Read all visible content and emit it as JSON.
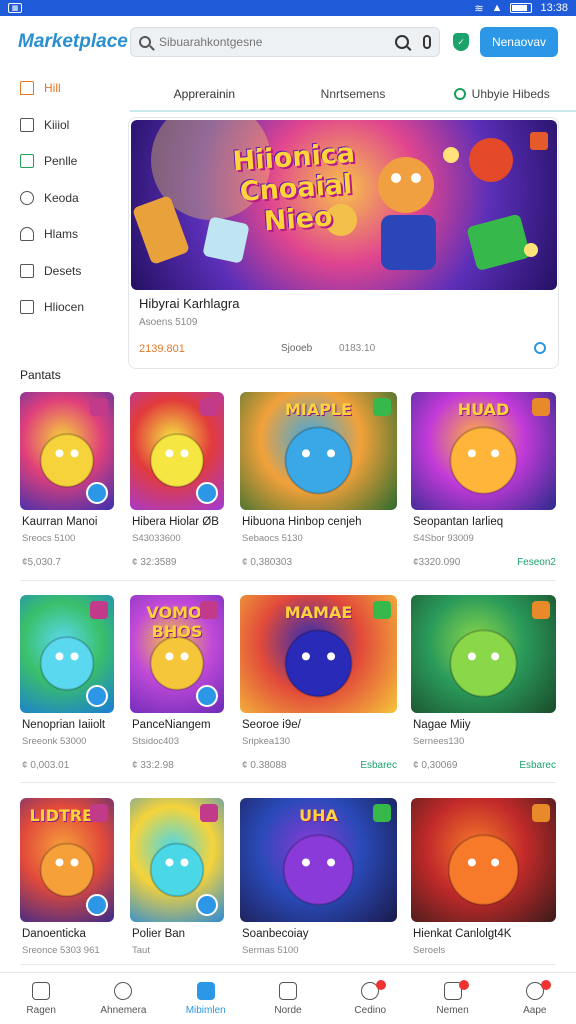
{
  "statusbar": {
    "time": "13:38"
  },
  "header": {
    "logo": "Marketplace",
    "search_placeholder": "Sibuarahkontgesne",
    "primary_button": "Nenaovav"
  },
  "sidebar": {
    "items": [
      {
        "label": "Hill",
        "icon": "home-icon"
      },
      {
        "label": "Kiiiol",
        "icon": "library-icon"
      },
      {
        "label": "Penlle",
        "icon": "calendar-icon"
      },
      {
        "label": "Keoda",
        "icon": "search-icon"
      },
      {
        "label": "Hlams",
        "icon": "user-icon"
      },
      {
        "label": "Desets",
        "icon": "document-icon"
      },
      {
        "label": "Hliocen",
        "icon": "file-icon"
      }
    ],
    "section_title": "Pantats"
  },
  "tabs": [
    {
      "label": "Apprerainin"
    },
    {
      "label": "Nnrtsemens"
    },
    {
      "label": "Uhbyie Hibeds"
    }
  ],
  "featured": {
    "art_text": "Hiionica Cnoaial Nieo",
    "title": "Hibyrai Karhlagra",
    "subtitle": "Asoens 5109",
    "price": "2139.801",
    "speed_label": "Sjooeb",
    "speed_value": "0183.10"
  },
  "cards": [
    {
      "name": "Kaurran Manoi",
      "sub": "Sreocs 5100",
      "price": "¢5,030.7",
      "tag": "",
      "art_text": ""
    },
    {
      "name": "Hibera Hiolar ØB",
      "sub": "S43033600",
      "price": "¢ 32:3589",
      "tag": "",
      "art_text": ""
    },
    {
      "name": "Hibuona Hinbop cenjeh",
      "sub": "Sebaocs 5130",
      "price": "¢ 0,380303",
      "tag": "",
      "art_text": "MIAPLE"
    },
    {
      "name": "Seopantan Iarlieq",
      "sub": "S4Sbor 93009",
      "price": "¢3320.090",
      "tag": "Feseon2",
      "art_text": "HUAD"
    },
    {
      "name": "Nenoprian Iaiiolt",
      "sub": "Sreeonk 53000",
      "price": "¢ 0,003.01",
      "tag": "",
      "art_text": ""
    },
    {
      "name": "PanceNiangem",
      "sub": "Stsidoc403",
      "price": "¢ 33:2.98",
      "tag": "",
      "art_text": "VOMOI BHOS"
    },
    {
      "name": "Seoroe i9e/",
      "sub": "Sripkea130",
      "price": "¢ 0.38088",
      "tag": "Esbarec",
      "art_text": "MAMAE"
    },
    {
      "name": "Nagae Miiy",
      "sub": "Sernees130",
      "price": "¢ 0,30069",
      "tag": "Esbarec",
      "art_text": ""
    },
    {
      "name": "Danoenticka",
      "sub": "Sreonce 5303 961",
      "price": "",
      "tag": "",
      "art_text": "LIDTRES"
    },
    {
      "name": "Polier Ban",
      "sub": "Taut",
      "price": "",
      "tag": "",
      "art_text": ""
    },
    {
      "name": "Soanbecoiay",
      "sub": "Sermas 5100",
      "price": "",
      "tag": "",
      "art_text": "UHA"
    },
    {
      "name": "Hienkat Canlolgt4K",
      "sub": "Seroels",
      "price": "",
      "tag": "",
      "art_text": ""
    }
  ],
  "bottombar": [
    {
      "label": "Ragen",
      "icon": "home-icon"
    },
    {
      "label": "Ahnemera",
      "icon": "search-icon"
    },
    {
      "label": "Mibimlen",
      "icon": "store-icon"
    },
    {
      "label": "Norde",
      "icon": "game-icon"
    },
    {
      "label": "Cedino",
      "icon": "notification-icon"
    },
    {
      "label": "Nemen",
      "icon": "inbox-icon"
    },
    {
      "label": "Aape",
      "icon": "profile-icon"
    }
  ],
  "colors": {
    "accent": "#2b97e6",
    "active_sidebar": "#e1792a",
    "tag_green": "#1aa36b",
    "statusbar": "#1f5bd8"
  }
}
